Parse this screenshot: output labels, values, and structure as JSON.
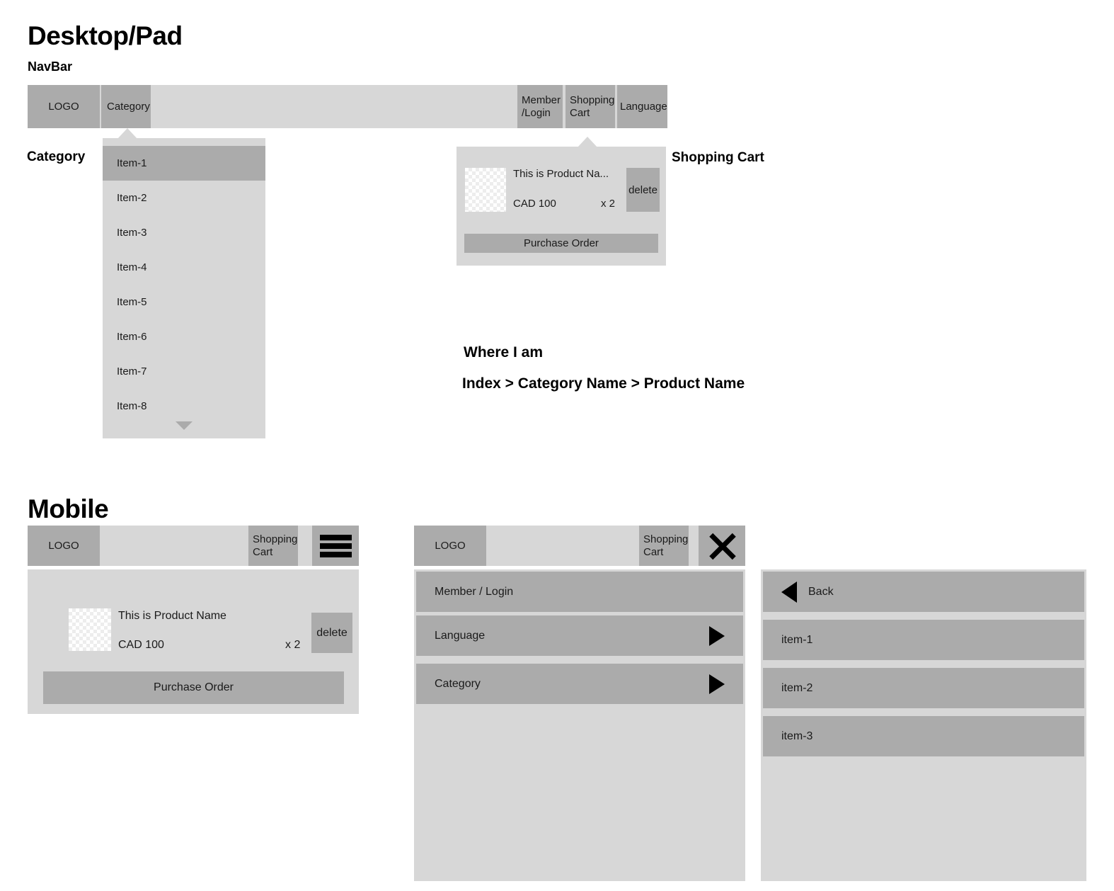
{
  "desktop": {
    "section_title": "Desktop/Pad",
    "navbar_label": "NavBar",
    "navbar": {
      "logo": "LOGO",
      "category": "Category",
      "member_login": "Member\n/Login",
      "member_login_line1": "Member",
      "member_login_line2": "/Login",
      "shopping_cart_line1": "Shopping",
      "shopping_cart_line2": "Cart",
      "language": "Language"
    },
    "category_panel": {
      "label": "Category",
      "items": [
        {
          "label": "Item-1",
          "selected": true
        },
        {
          "label": "Item-2",
          "selected": false
        },
        {
          "label": "Item-3",
          "selected": false
        },
        {
          "label": "Item-4",
          "selected": false
        },
        {
          "label": "Item-5",
          "selected": false
        },
        {
          "label": "Item-6",
          "selected": false
        },
        {
          "label": "Item-7",
          "selected": false
        },
        {
          "label": "Item-8",
          "selected": false
        }
      ],
      "more_icon": "chevron-down-icon"
    },
    "cart_panel": {
      "label": "Shopping Cart",
      "product_name": "This is Product Na...",
      "price": "CAD 100",
      "quantity": "x 2",
      "delete_label": "delete",
      "purchase_label": "Purchase Order",
      "thumbnail_icon": "product-thumbnail-placeholder"
    },
    "where_i_am": {
      "title": "Where I am",
      "path": "Index > Category Name > Product Name"
    }
  },
  "mobile": {
    "section_title": "Mobile",
    "panel_cart": {
      "logo": "LOGO",
      "shopping_cart_line1": "Shopping",
      "shopping_cart_line2": "Cart",
      "menu_icon": "hamburger-menu-icon",
      "product_name": "This is Product Name",
      "price": "CAD 100",
      "quantity": "x 2",
      "delete_label": "delete",
      "purchase_label": "Purchase Order",
      "thumbnail_icon": "product-thumbnail-placeholder"
    },
    "panel_menu": {
      "logo": "LOGO",
      "shopping_cart_line1": "Shopping",
      "shopping_cart_line2": "Cart",
      "close_icon": "close-x-icon",
      "items": [
        {
          "label": "Member / Login",
          "arrow": false
        },
        {
          "label": "Language",
          "arrow": true
        },
        {
          "label": "Category",
          "arrow": true
        }
      ]
    },
    "panel_submenu": {
      "back_label": "Back",
      "back_icon": "chevron-left-icon",
      "items": [
        {
          "label": "item-1"
        },
        {
          "label": "item-2"
        },
        {
          "label": "item-3"
        }
      ]
    }
  },
  "colors": {
    "tone_dark": "#ababab",
    "tone_light": "#d7d7d7",
    "text": "#1a1a1a",
    "page_background": "#ffffff"
  }
}
